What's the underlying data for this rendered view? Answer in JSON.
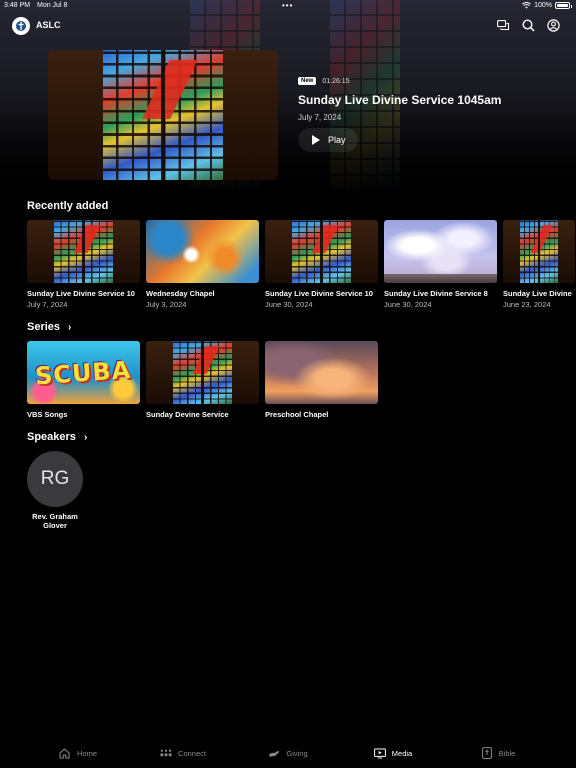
{
  "status_bar": {
    "time": "3:48 PM",
    "date": "Mon Jul 8",
    "dots": "•••",
    "battery": "100%",
    "battery_level": 1.0
  },
  "header": {
    "brand": "ASLC"
  },
  "featured": {
    "badge": "New",
    "duration": "01:26:15",
    "title": "Sunday Live Divine Service 1045am",
    "date": "July 7, 2024",
    "play_label": "Play"
  },
  "recently_added": {
    "title": "Recently added",
    "items": [
      {
        "title": "Sunday Live Divine Service 10",
        "date": "July 7, 2024",
        "art": "stained-glass"
      },
      {
        "title": "Wednesday Chapel",
        "date": "July 3, 2024",
        "art": "chapel"
      },
      {
        "title": "Sunday Live Divine Service 10",
        "date": "June 30, 2024",
        "art": "stained-glass"
      },
      {
        "title": "Sunday Live Divine Service 8",
        "date": "June 30, 2024",
        "art": "sky"
      },
      {
        "title": "Sunday Live Divine",
        "date": "June 23, 2024",
        "art": "stained-glass"
      }
    ]
  },
  "series": {
    "title": "Series",
    "items": [
      {
        "title": "VBS Songs",
        "art": "scuba",
        "art_text": "SCUBA"
      },
      {
        "title": "Sunday Devine Service",
        "art": "stained-glass"
      },
      {
        "title": "Preschool Chapel",
        "art": "clouds"
      }
    ]
  },
  "speakers": {
    "title": "Speakers",
    "items": [
      {
        "initials": "RG",
        "name": "Rev. Graham Glover"
      }
    ]
  },
  "tab_bar": {
    "active": "Media",
    "tabs": [
      {
        "label": "Home",
        "icon": "home-icon"
      },
      {
        "label": "Connect",
        "icon": "connect-icon"
      },
      {
        "label": "Giving",
        "icon": "giving-icon"
      },
      {
        "label": "Media",
        "icon": "media-icon"
      },
      {
        "label": "Bible",
        "icon": "bible-icon"
      }
    ]
  },
  "colors": {
    "background": "#000000",
    "muted_text": "#8a8a8e",
    "avatar": "#3a3a3c"
  }
}
